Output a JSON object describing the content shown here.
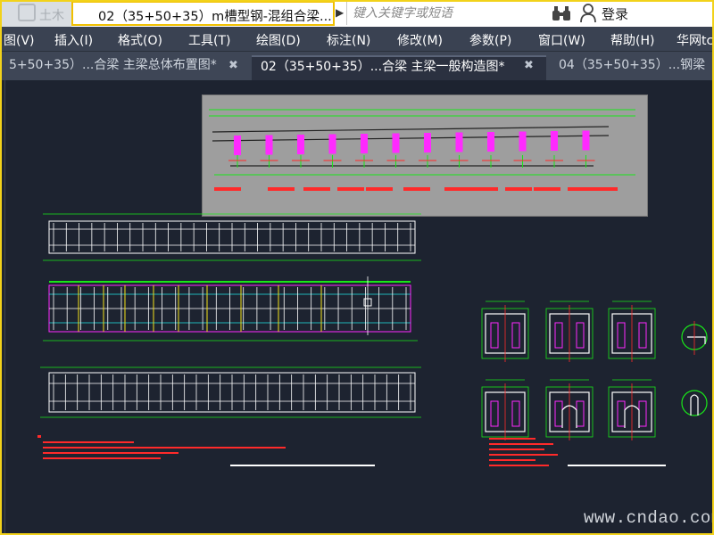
{
  "titlebar": {
    "logo_text": "土木网",
    "doc_title": "02（35+50+35）m槽型钢-混组合梁...",
    "search_placeholder": "键入关键字或短语",
    "login": "登录"
  },
  "menu": [
    {
      "label": "图(V)"
    },
    {
      "label": "插入(I)"
    },
    {
      "label": "格式(O)"
    },
    {
      "label": "工具(T)"
    },
    {
      "label": "绘图(D)"
    },
    {
      "label": "标注(N)"
    },
    {
      "label": "修改(M)"
    },
    {
      "label": "参数(P)"
    },
    {
      "label": "窗口(W)"
    },
    {
      "label": "帮助(H)"
    },
    {
      "label": "华网tc"
    }
  ],
  "tabs": [
    {
      "label": "5+50+35）...合梁 主梁总体布置图*",
      "close": "✖"
    },
    {
      "label": "02（35+50+35）...合梁 主梁一般构造图*",
      "close": "✖"
    },
    {
      "label": "04（35+50+35）...钢梁"
    }
  ],
  "drawing": {
    "watermark": "www.cndao.com",
    "colors": {
      "background": "#1d2330",
      "inset_bg": "#9e9e9e",
      "green": "#19e619",
      "white": "#ffffff",
      "red": "#ff2a2a",
      "magenta": "#ff2aff",
      "cyan": "#22e6e6",
      "yellow": "#f2e01a",
      "frame": "#f2d21a"
    }
  }
}
